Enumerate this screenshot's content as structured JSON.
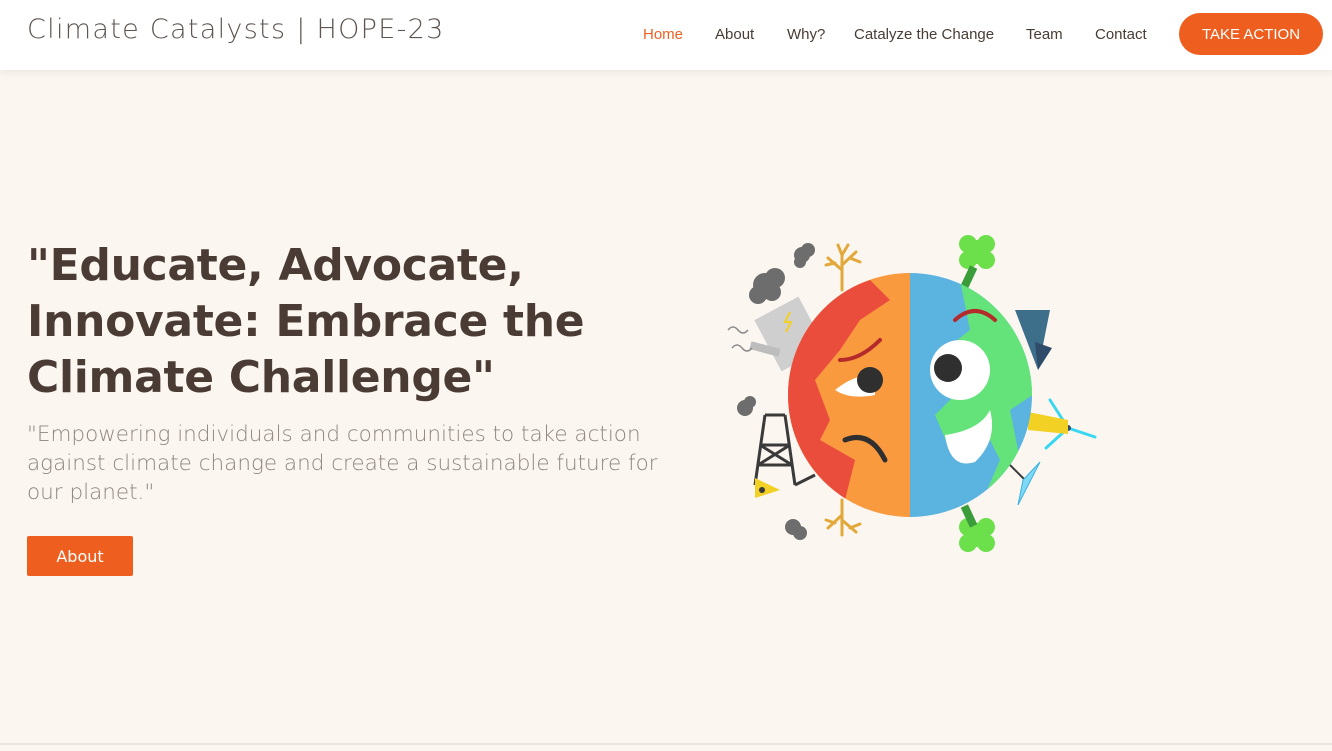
{
  "header": {
    "brand": "Climate Catalysts | HOPE-23",
    "nav": [
      {
        "label": "Home",
        "active": true
      },
      {
        "label": "About",
        "active": false
      },
      {
        "label": "Why?",
        "active": false
      },
      {
        "label": "Catalyze the Change",
        "active": false
      },
      {
        "label": "Team",
        "active": false
      },
      {
        "label": "Contact",
        "active": false
      }
    ],
    "cta_label": "TAKE ACTION"
  },
  "hero": {
    "title": "\"Educate, Advocate, Innovate: Embrace the Climate Challenge\"",
    "subtitle": "\"Empowering individuals and communities to take action against climate change and create a sustainable future for our planet.\"",
    "button_label": "About",
    "illustration": "half-polluted-half-green-earth-illustration"
  },
  "colors": {
    "accent": "#ee5f1f",
    "background": "#fcf6f1",
    "heading": "#4a3c35",
    "subtext": "#8e8580"
  }
}
